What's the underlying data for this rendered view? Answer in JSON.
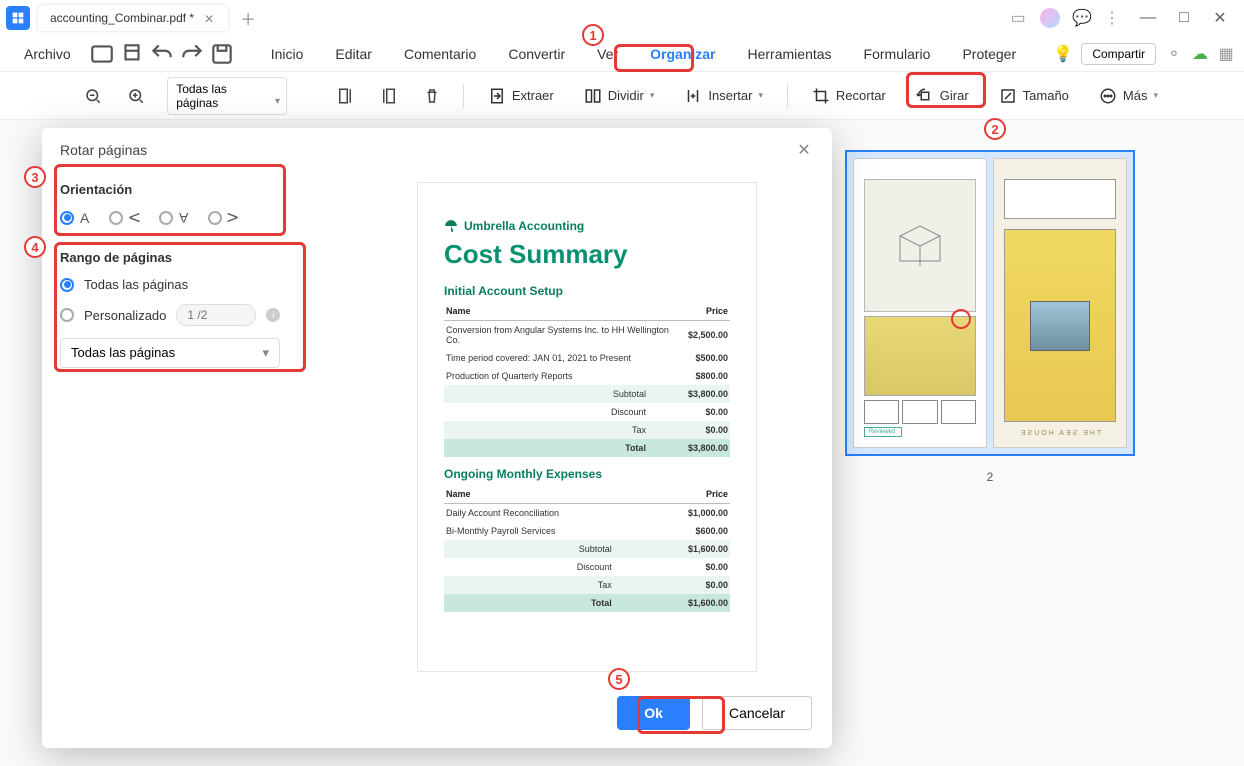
{
  "titlebar": {
    "tab_name": "accounting_Combinar.pdf *"
  },
  "menubar": {
    "file": "Archivo",
    "items": [
      "Inicio",
      "Editar",
      "Comentario",
      "Convertir",
      "Ver",
      "Organizar",
      "Herramientas",
      "Formulario",
      "Proteger"
    ],
    "share": "Compartir"
  },
  "toolbar": {
    "zoom_label": "Todas las páginas",
    "extract": "Extraer",
    "split": "Dividir",
    "insert": "Insertar",
    "crop": "Recortar",
    "rotate": "Girar",
    "size": "Tamaño",
    "more": "Más"
  },
  "dialog": {
    "title": "Rotar páginas",
    "orientation_label": "Orientación",
    "range_label": "Rango de páginas",
    "all_pages": "Todas las páginas",
    "custom": "Personalizado",
    "custom_placeholder": "1 /2",
    "select_value": "Todas las páginas",
    "ok": "Ok",
    "cancel": "Cancelar"
  },
  "preview": {
    "brand": "Umbrella Accounting",
    "title": "Cost Summary",
    "section1": "Initial Account Setup",
    "section2": "Ongoing Monthly Expenses",
    "col_name": "Name",
    "col_price": "Price",
    "table1": [
      {
        "name": "Conversion from Angular Systems Inc. to HH Wellington Co.",
        "price": "$2,500.00"
      },
      {
        "name": "Time period covered: JAN 01, 2021 to Present",
        "price": "$500.00"
      },
      {
        "name": "Production of Quarterly Reports",
        "price": "$800.00"
      }
    ],
    "summary1": [
      {
        "label": "Subtotal",
        "value": "$3,800.00",
        "cls": "sub"
      },
      {
        "label": "Discount",
        "value": "$0.00",
        "cls": ""
      },
      {
        "label": "Tax",
        "value": "$0.00",
        "cls": "sub"
      },
      {
        "label": "Total",
        "value": "$3,800.00",
        "cls": "tot"
      }
    ],
    "table2": [
      {
        "name": "Daily Account Reconciliation",
        "price": "$1,000.00"
      },
      {
        "name": "Bi-Monthly Payroll Services",
        "price": "$600.00"
      }
    ],
    "summary2": [
      {
        "label": "Subtotal",
        "value": "$1,600.00",
        "cls": "sub"
      },
      {
        "label": "Discount",
        "value": "$0.00",
        "cls": ""
      },
      {
        "label": "Tax",
        "value": "$0.00",
        "cls": "sub"
      },
      {
        "label": "Total",
        "value": "$1,600.00",
        "cls": "tot"
      }
    ]
  },
  "thumb": {
    "page2_num": "2",
    "sea_house": "THE SEA HOUSE",
    "reviewed": "Reviewed"
  },
  "callouts": {
    "1": "1",
    "2": "2",
    "3": "3",
    "4": "4",
    "5": "5"
  }
}
